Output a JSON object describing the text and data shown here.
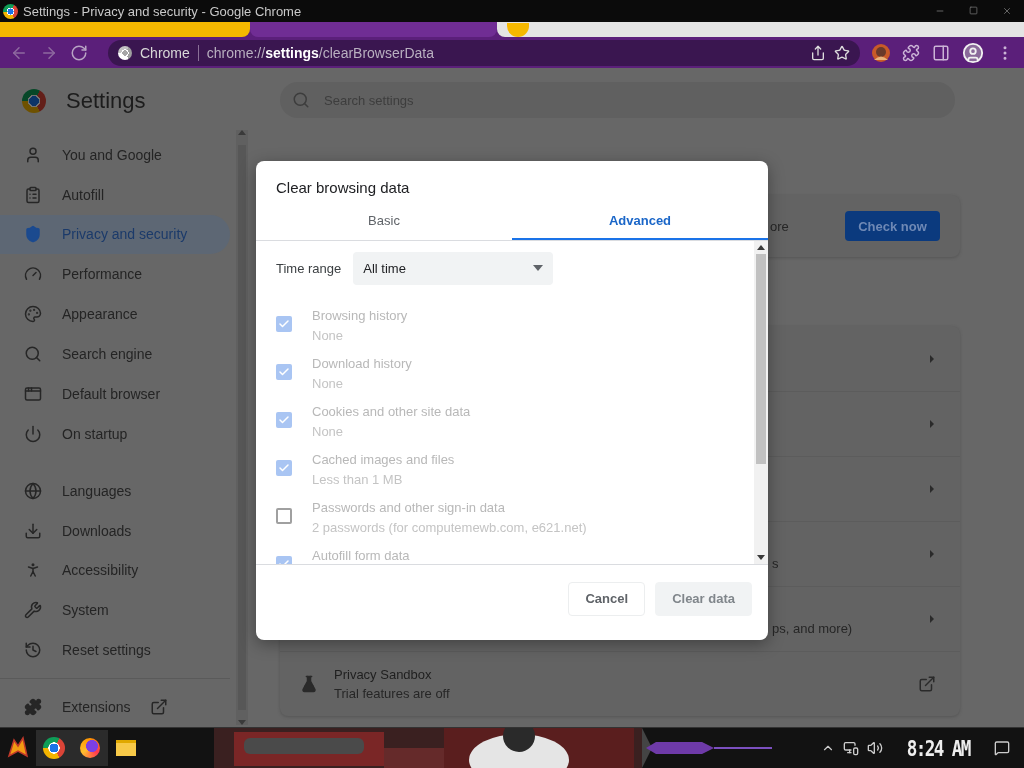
{
  "window": {
    "title": "Settings - Privacy and security - Google Chrome"
  },
  "toolbar": {
    "site_chip": "Chrome",
    "url": "chrome://**settings**/clearBrowserData"
  },
  "sidebar": {
    "title": "Settings",
    "sections": [
      {
        "items": [
          {
            "label": "You and Google",
            "selected": false
          },
          {
            "label": "Autofill",
            "selected": false
          },
          {
            "label": "Privacy and security",
            "selected": true
          },
          {
            "label": "Performance",
            "selected": false
          },
          {
            "label": "Appearance",
            "selected": false
          },
          {
            "label": "Search engine",
            "selected": false
          },
          {
            "label": "Default browser",
            "selected": false
          },
          {
            "label": "On startup",
            "selected": false
          }
        ]
      },
      {
        "items": [
          {
            "label": "Languages",
            "selected": false
          },
          {
            "label": "Downloads",
            "selected": false
          },
          {
            "label": "Accessibility",
            "selected": false
          },
          {
            "label": "System",
            "selected": false
          },
          {
            "label": "Reset settings",
            "selected": false
          }
        ]
      }
    ],
    "extensions": {
      "label": "Extensions"
    }
  },
  "search": {
    "placeholder": "Search settings"
  },
  "safety_card": {
    "text_fragment": "ore",
    "button": "Check now"
  },
  "privacy_rows": [
    {
      "kind": "subpage"
    },
    {
      "kind": "subpage"
    },
    {
      "kind": "subpage"
    },
    {
      "kind": "subpage",
      "text_fragment": "s"
    },
    {
      "kind": "subpage",
      "text_fragment": "ps, and more)"
    },
    {
      "kind": "external",
      "title": "Privacy Sandbox",
      "subtitle": "Trial features are off"
    }
  ],
  "dialog": {
    "title": "Clear browsing data",
    "tabs": [
      {
        "label": "Basic",
        "selected": false
      },
      {
        "label": "Advanced",
        "selected": true
      }
    ],
    "time_range": {
      "label": "Time range",
      "value": "All time"
    },
    "items": [
      {
        "label": "Browsing history",
        "detail": "None",
        "checked": true,
        "disabled": true
      },
      {
        "label": "Download history",
        "detail": "None",
        "checked": true,
        "disabled": true
      },
      {
        "label": "Cookies and other site data",
        "detail": "None",
        "checked": true,
        "disabled": true
      },
      {
        "label": "Cached images and files",
        "detail": "Less than 1 MB",
        "checked": true,
        "disabled": true
      },
      {
        "label": "Passwords and other sign-in data",
        "detail": "2 passwords (for computemewb.com, e621.net)",
        "checked": false,
        "disabled": true
      },
      {
        "label": "Autofill form data",
        "checked": true,
        "disabled": true
      }
    ],
    "buttons": [
      {
        "label": "Cancel",
        "disabled": false
      },
      {
        "label": "Clear data",
        "disabled": true
      }
    ]
  },
  "taskbar": {
    "time": "8:24 AM"
  }
}
